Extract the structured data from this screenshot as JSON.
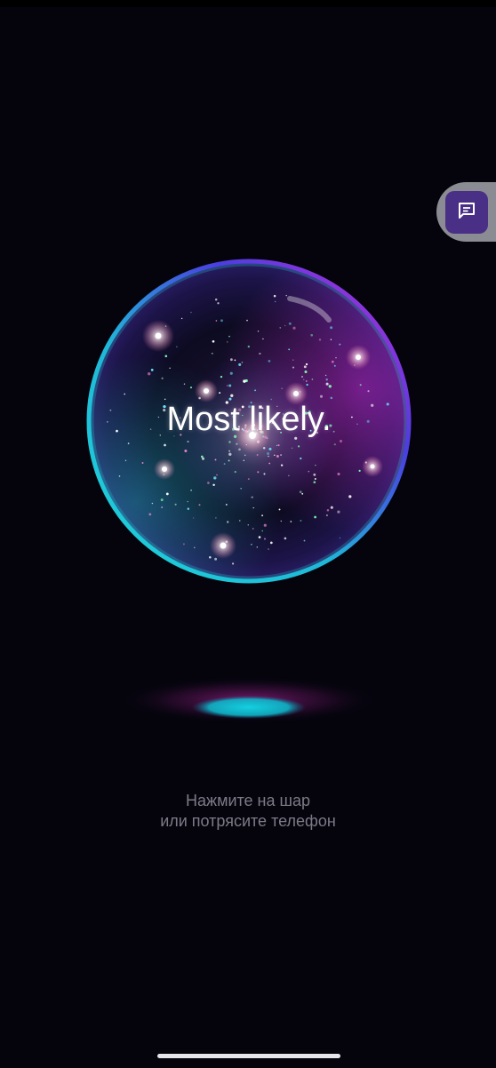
{
  "answer": {
    "text": "Most likely."
  },
  "hint": {
    "line1": "Нажмите на шар",
    "line2": "или потрясите телефон"
  },
  "feedback": {
    "icon": "chat-bubble-icon"
  },
  "colors": {
    "background": "#05040d",
    "orb_rim_cyan": "#1fd3d8",
    "orb_rim_magenta": "#c52bd6",
    "orb_rim_blue": "#4a3ee0",
    "shadow_cyan": "#13d0e0",
    "shadow_magenta": "#a0208e",
    "feedback_button": "#4a2f86",
    "hint_text": "#7d7a86"
  }
}
